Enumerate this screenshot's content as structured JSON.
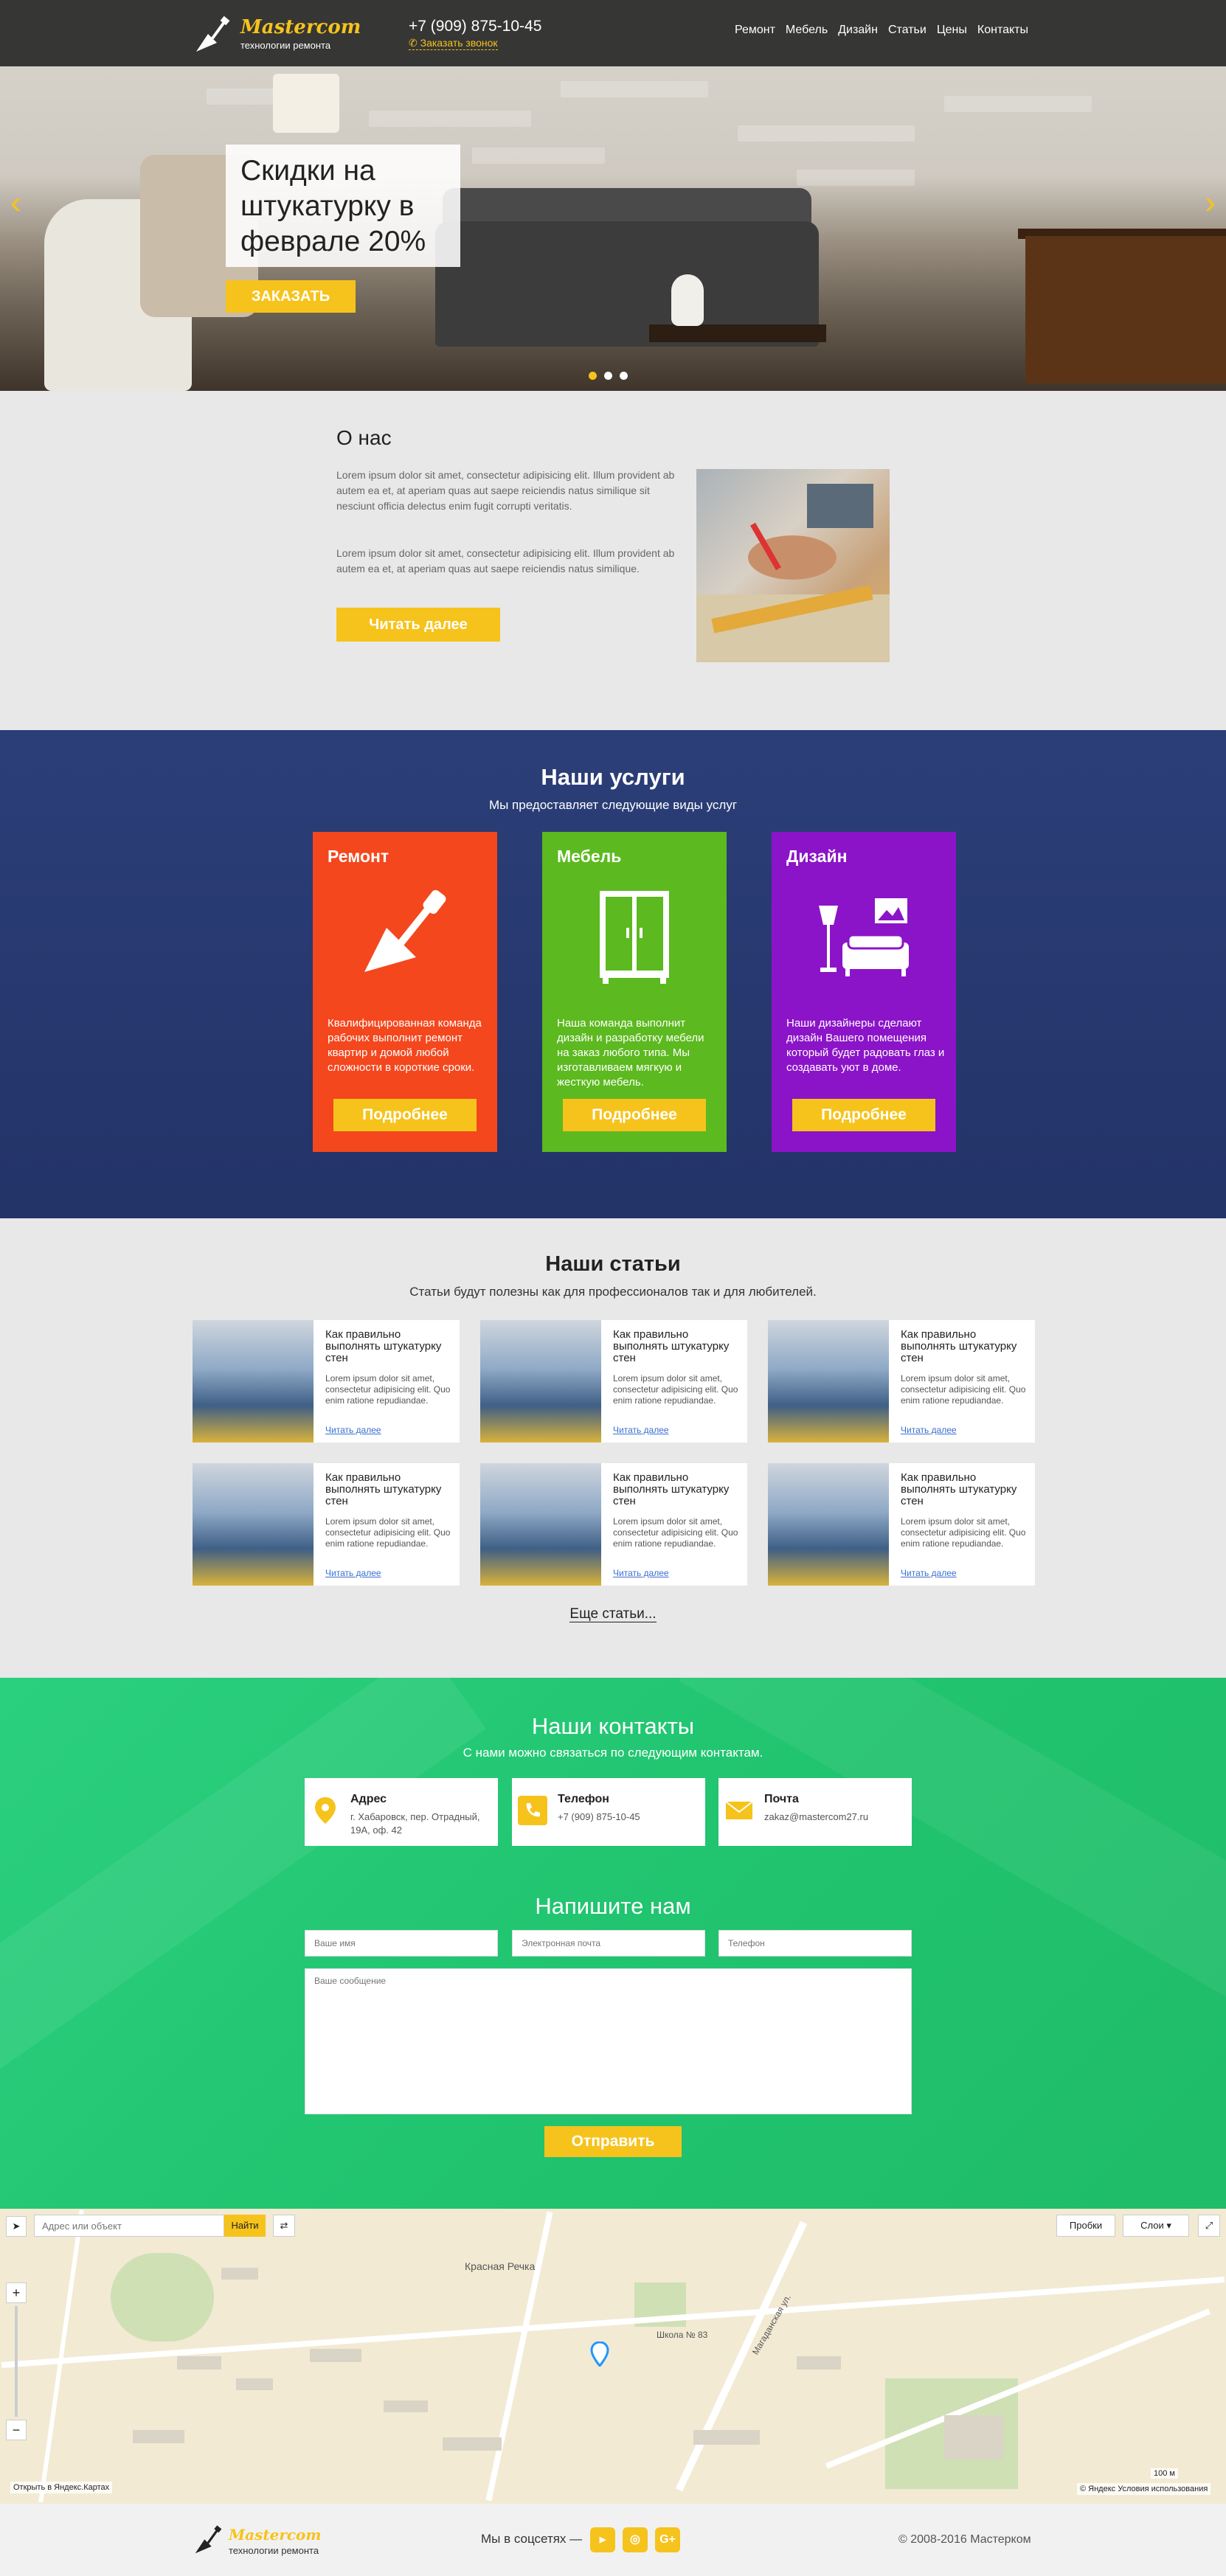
{
  "header": {
    "logo_name": "Mastercom",
    "logo_tagline": "технологии ремонта",
    "phone": "+7 (909) 875-10-45",
    "callback": "Заказать звонок",
    "nav": [
      "Ремонт",
      "Мебель",
      "Дизайн",
      "Статьи",
      "Цены",
      "Контакты"
    ]
  },
  "hero": {
    "title": "Скидки на штукатурку в феврале 20%",
    "button": "ЗАКАЗАТЬ",
    "slide_count": 3,
    "active_slide": 1
  },
  "about": {
    "title": "О нас",
    "p1": "Lorem ipsum dolor sit amet, consectetur adipisicing elit. Illum provident ab autem ea et, at aperiam quas aut saepe reiciendis natus similique sit nesciunt officia delectus enim fugit corrupti veritatis.",
    "p2": "Lorem ipsum dolor sit amet, consectetur adipisicing elit. Illum provident ab autem ea et, at aperiam quas aut saepe reiciendis natus similique.",
    "button": "Читать далее"
  },
  "services": {
    "title": "Наши услуги",
    "subtitle": "Мы предоставляет следующие виды услуг",
    "items": [
      {
        "title": "Ремонт",
        "text": "Квалифицированная команда рабочих выполнит ремонт квартир и домой любой сложности в короткие сроки.",
        "button": "Подробнее",
        "color": "#f4471d",
        "icon": "trowel-icon"
      },
      {
        "title": "Мебель",
        "text": "Наша команда выполнит дизайн и разработку мебели на заказ любого типа. Мы изготавливаем мягкую и жесткую мебель.",
        "button": "Подробнее",
        "color": "#5cb91f",
        "icon": "wardrobe-icon"
      },
      {
        "title": "Дизайн",
        "text": "Наши дизайнеры сделают дизайн Вашего помещения который будет радовать глаз и создавать уют в доме.",
        "button": "Подробнее",
        "color": "#8b14c8",
        "icon": "interior-icon"
      }
    ]
  },
  "articles": {
    "title": "Наши статьи",
    "subtitle": "Статьи будут полезны как для профессионалов так и для любителей.",
    "items": [
      {
        "title": "Как правильно выполнять штукатурку стен",
        "text": "Lorem ipsum dolor sit amet, consectetur adipisicing elit. Quo enim ratione repudiandae.",
        "link": "Читать далее"
      },
      {
        "title": "Как правильно выполнять штукатурку стен",
        "text": "Lorem ipsum dolor sit amet, consectetur adipisicing elit. Quo enim ratione repudiandae.",
        "link": "Читать далее"
      },
      {
        "title": "Как правильно выполнять штукатурку стен",
        "text": "Lorem ipsum dolor sit amet, consectetur adipisicing elit. Quo enim ratione repudiandae.",
        "link": "Читать далее"
      },
      {
        "title": "Как правильно выполнять штукатурку стен",
        "text": "Lorem ipsum dolor sit amet, consectetur adipisicing elit. Quo enim ratione repudiandae.",
        "link": "Читать далее"
      },
      {
        "title": "Как правильно выполнять штукатурку стен",
        "text": "Lorem ipsum dolor sit amet, consectetur adipisicing elit. Quo enim ratione repudiandae.",
        "link": "Читать далее"
      },
      {
        "title": "Как правильно выполнять штукатурку стен",
        "text": "Lorem ipsum dolor sit amet, consectetur adipisicing elit. Quo enim ratione repudiandae.",
        "link": "Читать далее"
      }
    ],
    "more": "Еще статьи..."
  },
  "contacts": {
    "title": "Наши контакты",
    "subtitle": "С нами можно связаться по следующим контактам.",
    "cards": [
      {
        "label": "Адрес",
        "value": "г. Хабаровск, пер. Отрадный, 19А, оф. 42",
        "icon": "map-pin-icon"
      },
      {
        "label": "Телефон",
        "value": "+7 (909) 875-10-45",
        "icon": "phone-icon"
      },
      {
        "label": "Почта",
        "value": "zakaz@mastercom27.ru",
        "icon": "mail-icon"
      }
    ],
    "form_title": "Напишите нам",
    "name_placeholder": "Ваше имя",
    "email_placeholder": "Электронная почта",
    "phone_placeholder": "Телефон",
    "message_placeholder": "Ваше сообщение",
    "send": "Отправить"
  },
  "map": {
    "search_placeholder": "Адрес или объект",
    "find": "Найти",
    "traffic": "Пробки",
    "layers": "Слои",
    "label_area": "Красная Речка",
    "label_school": "Школа № 83",
    "label_street": "Магаданская ул.",
    "open_link": "Открыть в Яндекс.Картах",
    "scale": "100 м",
    "credits": "© Яндекс Условия использования"
  },
  "footer": {
    "logo_name": "Mastercom",
    "logo_tagline": "технологии ремонта",
    "social_label": "Мы в соцсетях —",
    "social": [
      "youtube-icon",
      "instagram-icon",
      "google-plus-icon"
    ],
    "copyright": "© 2008-2016 Мастерком"
  },
  "colors": {
    "accent": "#f6c31c",
    "services_bg": "#1c306e",
    "contacts_bg": "#22c470"
  }
}
